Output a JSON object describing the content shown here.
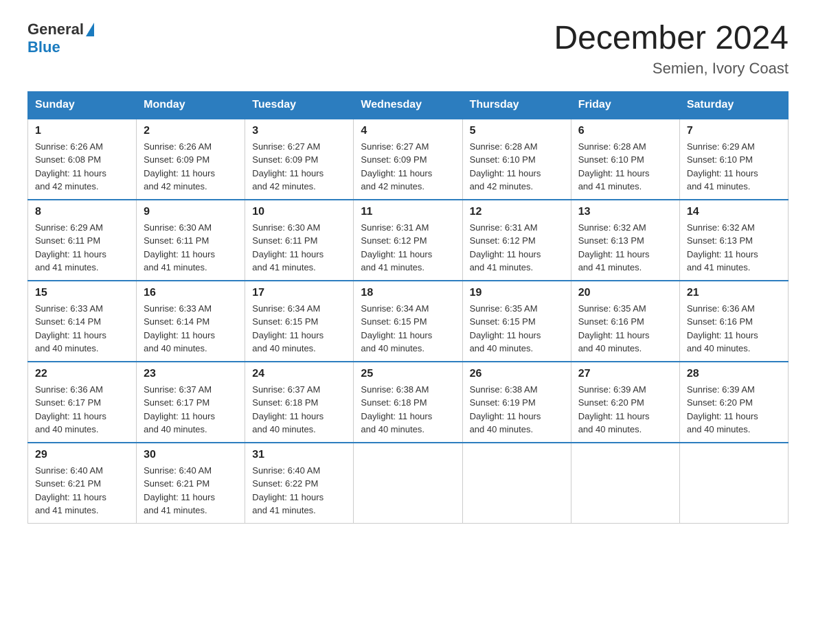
{
  "header": {
    "logo_general": "General",
    "logo_blue": "Blue",
    "title": "December 2024",
    "location": "Semien, Ivory Coast"
  },
  "days_of_week": [
    "Sunday",
    "Monday",
    "Tuesday",
    "Wednesday",
    "Thursday",
    "Friday",
    "Saturday"
  ],
  "weeks": [
    [
      {
        "day": "1",
        "sunrise": "6:26 AM",
        "sunset": "6:08 PM",
        "daylight": "11 hours and 42 minutes."
      },
      {
        "day": "2",
        "sunrise": "6:26 AM",
        "sunset": "6:09 PM",
        "daylight": "11 hours and 42 minutes."
      },
      {
        "day": "3",
        "sunrise": "6:27 AM",
        "sunset": "6:09 PM",
        "daylight": "11 hours and 42 minutes."
      },
      {
        "day": "4",
        "sunrise": "6:27 AM",
        "sunset": "6:09 PM",
        "daylight": "11 hours and 42 minutes."
      },
      {
        "day": "5",
        "sunrise": "6:28 AM",
        "sunset": "6:10 PM",
        "daylight": "11 hours and 42 minutes."
      },
      {
        "day": "6",
        "sunrise": "6:28 AM",
        "sunset": "6:10 PM",
        "daylight": "11 hours and 41 minutes."
      },
      {
        "day": "7",
        "sunrise": "6:29 AM",
        "sunset": "6:10 PM",
        "daylight": "11 hours and 41 minutes."
      }
    ],
    [
      {
        "day": "8",
        "sunrise": "6:29 AM",
        "sunset": "6:11 PM",
        "daylight": "11 hours and 41 minutes."
      },
      {
        "day": "9",
        "sunrise": "6:30 AM",
        "sunset": "6:11 PM",
        "daylight": "11 hours and 41 minutes."
      },
      {
        "day": "10",
        "sunrise": "6:30 AM",
        "sunset": "6:11 PM",
        "daylight": "11 hours and 41 minutes."
      },
      {
        "day": "11",
        "sunrise": "6:31 AM",
        "sunset": "6:12 PM",
        "daylight": "11 hours and 41 minutes."
      },
      {
        "day": "12",
        "sunrise": "6:31 AM",
        "sunset": "6:12 PM",
        "daylight": "11 hours and 41 minutes."
      },
      {
        "day": "13",
        "sunrise": "6:32 AM",
        "sunset": "6:13 PM",
        "daylight": "11 hours and 41 minutes."
      },
      {
        "day": "14",
        "sunrise": "6:32 AM",
        "sunset": "6:13 PM",
        "daylight": "11 hours and 41 minutes."
      }
    ],
    [
      {
        "day": "15",
        "sunrise": "6:33 AM",
        "sunset": "6:14 PM",
        "daylight": "11 hours and 40 minutes."
      },
      {
        "day": "16",
        "sunrise": "6:33 AM",
        "sunset": "6:14 PM",
        "daylight": "11 hours and 40 minutes."
      },
      {
        "day": "17",
        "sunrise": "6:34 AM",
        "sunset": "6:15 PM",
        "daylight": "11 hours and 40 minutes."
      },
      {
        "day": "18",
        "sunrise": "6:34 AM",
        "sunset": "6:15 PM",
        "daylight": "11 hours and 40 minutes."
      },
      {
        "day": "19",
        "sunrise": "6:35 AM",
        "sunset": "6:15 PM",
        "daylight": "11 hours and 40 minutes."
      },
      {
        "day": "20",
        "sunrise": "6:35 AM",
        "sunset": "6:16 PM",
        "daylight": "11 hours and 40 minutes."
      },
      {
        "day": "21",
        "sunrise": "6:36 AM",
        "sunset": "6:16 PM",
        "daylight": "11 hours and 40 minutes."
      }
    ],
    [
      {
        "day": "22",
        "sunrise": "6:36 AM",
        "sunset": "6:17 PM",
        "daylight": "11 hours and 40 minutes."
      },
      {
        "day": "23",
        "sunrise": "6:37 AM",
        "sunset": "6:17 PM",
        "daylight": "11 hours and 40 minutes."
      },
      {
        "day": "24",
        "sunrise": "6:37 AM",
        "sunset": "6:18 PM",
        "daylight": "11 hours and 40 minutes."
      },
      {
        "day": "25",
        "sunrise": "6:38 AM",
        "sunset": "6:18 PM",
        "daylight": "11 hours and 40 minutes."
      },
      {
        "day": "26",
        "sunrise": "6:38 AM",
        "sunset": "6:19 PM",
        "daylight": "11 hours and 40 minutes."
      },
      {
        "day": "27",
        "sunrise": "6:39 AM",
        "sunset": "6:20 PM",
        "daylight": "11 hours and 40 minutes."
      },
      {
        "day": "28",
        "sunrise": "6:39 AM",
        "sunset": "6:20 PM",
        "daylight": "11 hours and 40 minutes."
      }
    ],
    [
      {
        "day": "29",
        "sunrise": "6:40 AM",
        "sunset": "6:21 PM",
        "daylight": "11 hours and 41 minutes."
      },
      {
        "day": "30",
        "sunrise": "6:40 AM",
        "sunset": "6:21 PM",
        "daylight": "11 hours and 41 minutes."
      },
      {
        "day": "31",
        "sunrise": "6:40 AM",
        "sunset": "6:22 PM",
        "daylight": "11 hours and 41 minutes."
      },
      null,
      null,
      null,
      null
    ]
  ],
  "labels": {
    "sunrise": "Sunrise:",
    "sunset": "Sunset:",
    "daylight": "Daylight:"
  }
}
